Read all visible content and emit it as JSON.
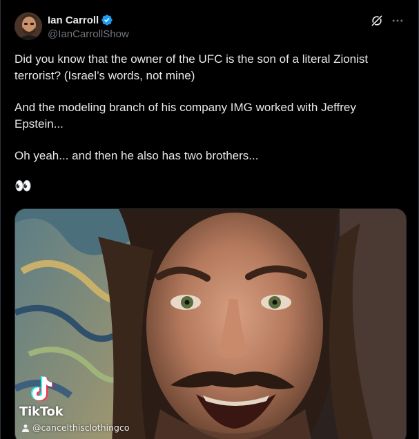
{
  "author": {
    "display_name": "Ian Carroll",
    "handle": "@IanCarrollShow",
    "verified": true,
    "verified_color": "#1d9bf0"
  },
  "tweet": {
    "paragraphs": [
      "Did you know that the owner of the UFC is the son of a literal Zionist terrorist? (Israel’s words, not mine)",
      "And the modeling branch of his company IMG worked with Jeffrey Epstein...",
      "Oh yeah... and then he also has two brothers...",
      "👀"
    ]
  },
  "header_icons": {
    "grok": "grok-icon",
    "more": "more-icon"
  },
  "media": {
    "watermark_brand": "TikTok",
    "watermark_user": "@cancelthisclothingco"
  },
  "colors": {
    "background": "#000000",
    "text": "#e7e9ea",
    "secondary_text": "#71767b",
    "border": "#2f3336"
  }
}
